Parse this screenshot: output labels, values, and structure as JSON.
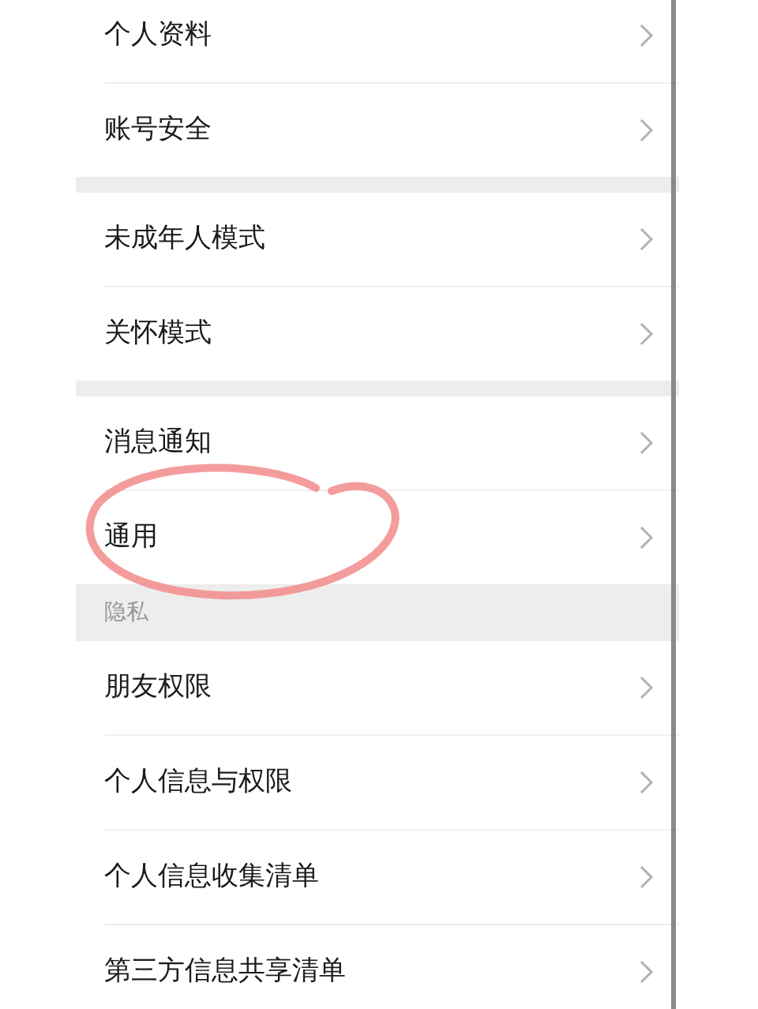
{
  "groups": [
    {
      "items": [
        {
          "label": "个人资料",
          "circled": false
        },
        {
          "label": "账号安全",
          "circled": false
        }
      ]
    },
    {
      "items": [
        {
          "label": "未成年人模式",
          "circled": false
        },
        {
          "label": "关怀模式",
          "circled": false
        }
      ]
    },
    {
      "items": [
        {
          "label": "消息通知",
          "circled": false
        },
        {
          "label": "通用",
          "circled": true
        }
      ]
    },
    {
      "header": "隐私",
      "items": [
        {
          "label": "朋友权限",
          "circled": false
        },
        {
          "label": "个人信息与权限",
          "circled": false
        },
        {
          "label": "个人信息收集清单",
          "circled": false
        },
        {
          "label": "第三方信息共享清单",
          "circled": false
        }
      ]
    }
  ]
}
